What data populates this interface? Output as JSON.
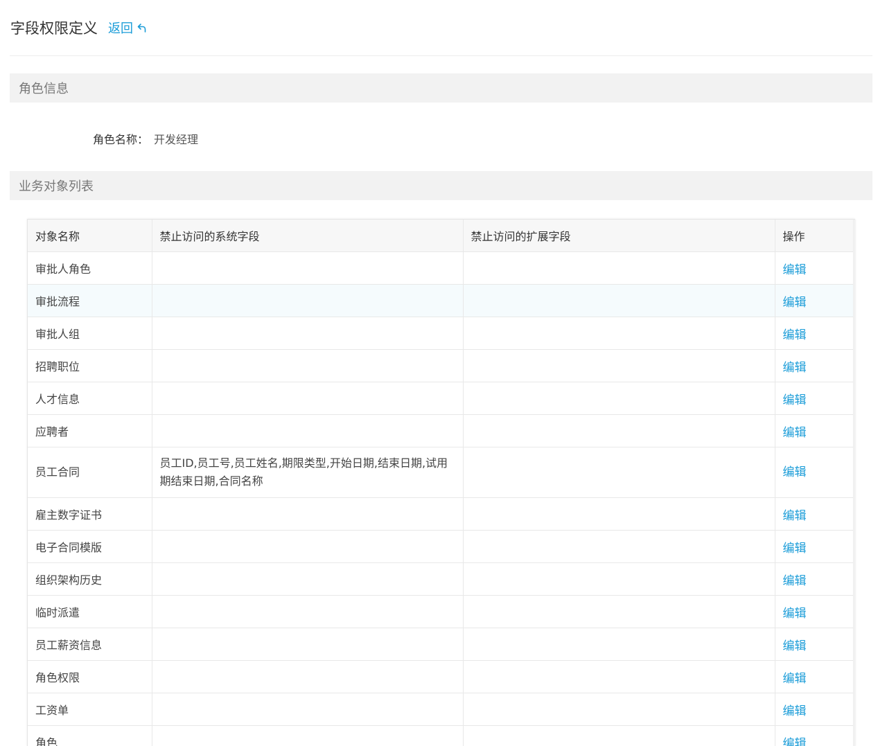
{
  "header": {
    "title": "字段权限定义",
    "back_label": "返回"
  },
  "role_section": {
    "title": "角色信息",
    "name_label": "角色名称：",
    "name_value": "开发经理"
  },
  "objects_section": {
    "title": "业务对象列表"
  },
  "table": {
    "columns": [
      "对象名称",
      "禁止访问的系统字段",
      "禁止访问的扩展字段",
      "操作"
    ],
    "rows": [
      {
        "name": "审批人角色",
        "system_fields": "",
        "ext_fields": "",
        "action": "编辑"
      },
      {
        "name": "审批流程",
        "system_fields": "",
        "ext_fields": "",
        "action": "编辑"
      },
      {
        "name": "审批人组",
        "system_fields": "",
        "ext_fields": "",
        "action": "编辑"
      },
      {
        "name": "招聘职位",
        "system_fields": "",
        "ext_fields": "",
        "action": "编辑"
      },
      {
        "name": "人才信息",
        "system_fields": "",
        "ext_fields": "",
        "action": "编辑"
      },
      {
        "name": "应聘者",
        "system_fields": "",
        "ext_fields": "",
        "action": "编辑"
      },
      {
        "name": "员工合同",
        "system_fields": "员工ID,员工号,员工姓名,期限类型,开始日期,结束日期,试用期结束日期,合同名称",
        "ext_fields": "",
        "action": "编辑"
      },
      {
        "name": "雇主数字证书",
        "system_fields": "",
        "ext_fields": "",
        "action": "编辑"
      },
      {
        "name": "电子合同模版",
        "system_fields": "",
        "ext_fields": "",
        "action": "编辑"
      },
      {
        "name": "组织架构历史",
        "system_fields": "",
        "ext_fields": "",
        "action": "编辑"
      },
      {
        "name": "临时派遣",
        "system_fields": "",
        "ext_fields": "",
        "action": "编辑"
      },
      {
        "name": "员工薪资信息",
        "system_fields": "",
        "ext_fields": "",
        "action": "编辑"
      },
      {
        "name": "角色权限",
        "system_fields": "",
        "ext_fields": "",
        "action": "编辑"
      },
      {
        "name": "工资单",
        "system_fields": "",
        "ext_fields": "",
        "action": "编辑"
      },
      {
        "name": "角色",
        "system_fields": "",
        "ext_fields": "",
        "action": "编辑"
      }
    ]
  },
  "colors": {
    "accent": "#1a9cd8",
    "section_bg": "#f2f2f2",
    "highlight_row": "#f5fbfd"
  },
  "icons": {
    "back": "undo-arrow-icon"
  }
}
